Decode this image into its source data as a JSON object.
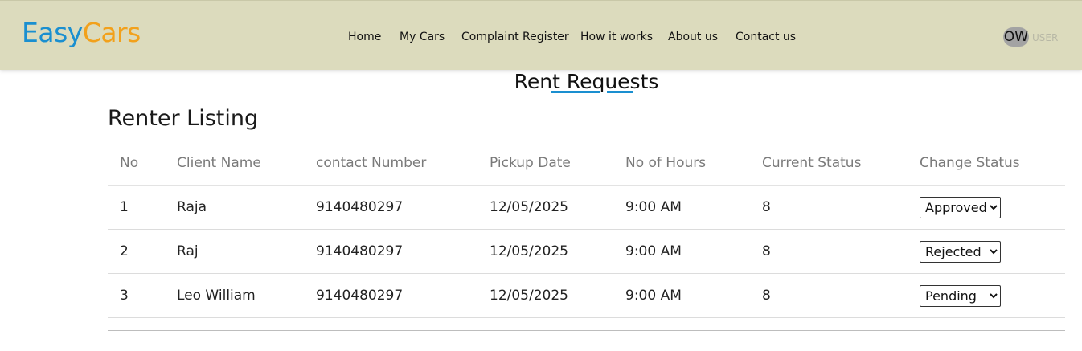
{
  "brand": {
    "part1": "Easy",
    "part2": "Cars",
    "color1": "#1a8fd0",
    "color2": "#f2a11c"
  },
  "nav": {
    "items": [
      "Home",
      "My Cars",
      "Complaint Register",
      "How it works",
      "About us",
      "Contact us"
    ]
  },
  "user": {
    "initials": "OW",
    "label": "USER"
  },
  "page": {
    "heading": "Rent Requests",
    "section_title": "Renter Listing"
  },
  "table": {
    "headers": [
      "No",
      "Client Name",
      "contact Number",
      "Pickup Date",
      "No of Hours",
      "Current Status",
      "Change Status"
    ],
    "status_options": [
      "Approved",
      "Rejected",
      "Pending"
    ],
    "rows": [
      {
        "no": "1",
        "client": "Raja",
        "contact": "9140480297",
        "date": "12/05/2025",
        "hours": "9:00 AM",
        "current": "8",
        "selected": "Approved"
      },
      {
        "no": "2",
        "client": "Raj",
        "contact": "9140480297",
        "date": "12/05/2025",
        "hours": "9:00 AM",
        "current": "8",
        "selected": "Rejected"
      },
      {
        "no": "3",
        "client": "Leo William",
        "contact": "9140480297",
        "date": "12/05/2025",
        "hours": "9:00 AM",
        "current": "8",
        "selected": "Pending"
      }
    ]
  },
  "theme": {
    "navbar_bg": "#dcdbbd",
    "accent": "#1a8fd0"
  }
}
